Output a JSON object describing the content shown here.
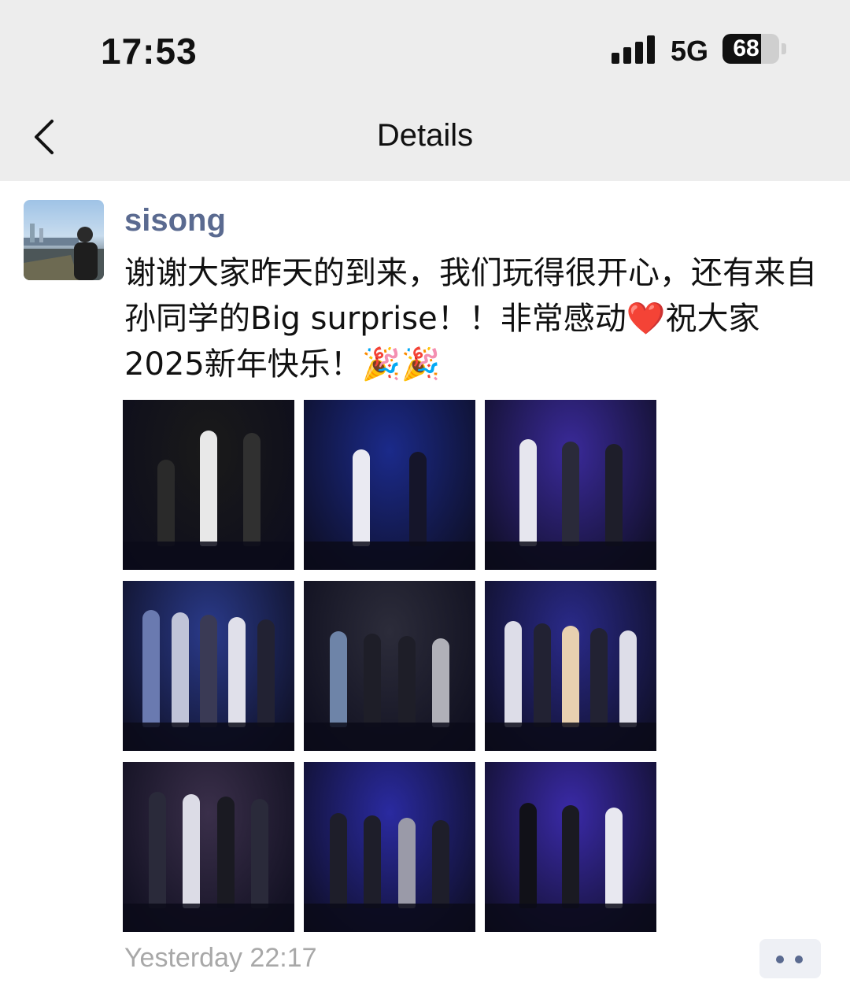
{
  "status_bar": {
    "time": "17:53",
    "network": "5G",
    "battery_percent": "68",
    "battery_level": 0.68
  },
  "nav": {
    "title": "Details",
    "back_icon": "chevron-left-icon"
  },
  "post": {
    "author": "sisong",
    "text": "谢谢大家昨天的到来，我们玩得很开心，还有来自孙同学的Big surprise！！非常感动❤️祝大家2025新年快乐！🎉🎉",
    "timestamp": "Yesterday 22:17",
    "more_icon": "more-dots-icon",
    "photos": [
      {
        "name": "photo-1",
        "bg": "#1a1a1a",
        "figs": [
          "#2a2a2a",
          "#e8e8e8",
          "#303030"
        ]
      },
      {
        "name": "photo-2",
        "bg": "#1b2a8a",
        "figs": [
          "#eaeaf2",
          "#15152a"
        ]
      },
      {
        "name": "photo-3",
        "bg": "#3a2a9a",
        "figs": [
          "#e6e6ee",
          "#2a2a3a",
          "#1e1e2a"
        ]
      },
      {
        "name": "photo-4",
        "bg": "#2a3a8a",
        "figs": [
          "#6a7ab0",
          "#c0c4d8",
          "#3a3a55",
          "#e0e0ea",
          "#222233"
        ]
      },
      {
        "name": "photo-5",
        "bg": "#2c2c3a",
        "figs": [
          "#6e84a8",
          "#1e1e28",
          "#1e1e28",
          "#b0b0b8"
        ]
      },
      {
        "name": "photo-6",
        "bg": "#2a2a8a",
        "figs": [
          "#dddde8",
          "#223",
          "#e8d0b0",
          "#223",
          "#dddde8"
        ]
      },
      {
        "name": "photo-7",
        "bg": "#3a2f4a",
        "figs": [
          "#2a2a3a",
          "#dcdce6",
          "#1a1a22",
          "#2a2a3a"
        ]
      },
      {
        "name": "photo-8",
        "bg": "#2a2aa0",
        "figs": [
          "#1e1e2a",
          "#1e1e2a",
          "#9a9aa8",
          "#1e1e2a"
        ]
      },
      {
        "name": "photo-9",
        "bg": "#3a2aa8",
        "figs": [
          "#111118",
          "#1a1a22",
          "#e8e8f0"
        ]
      }
    ]
  }
}
